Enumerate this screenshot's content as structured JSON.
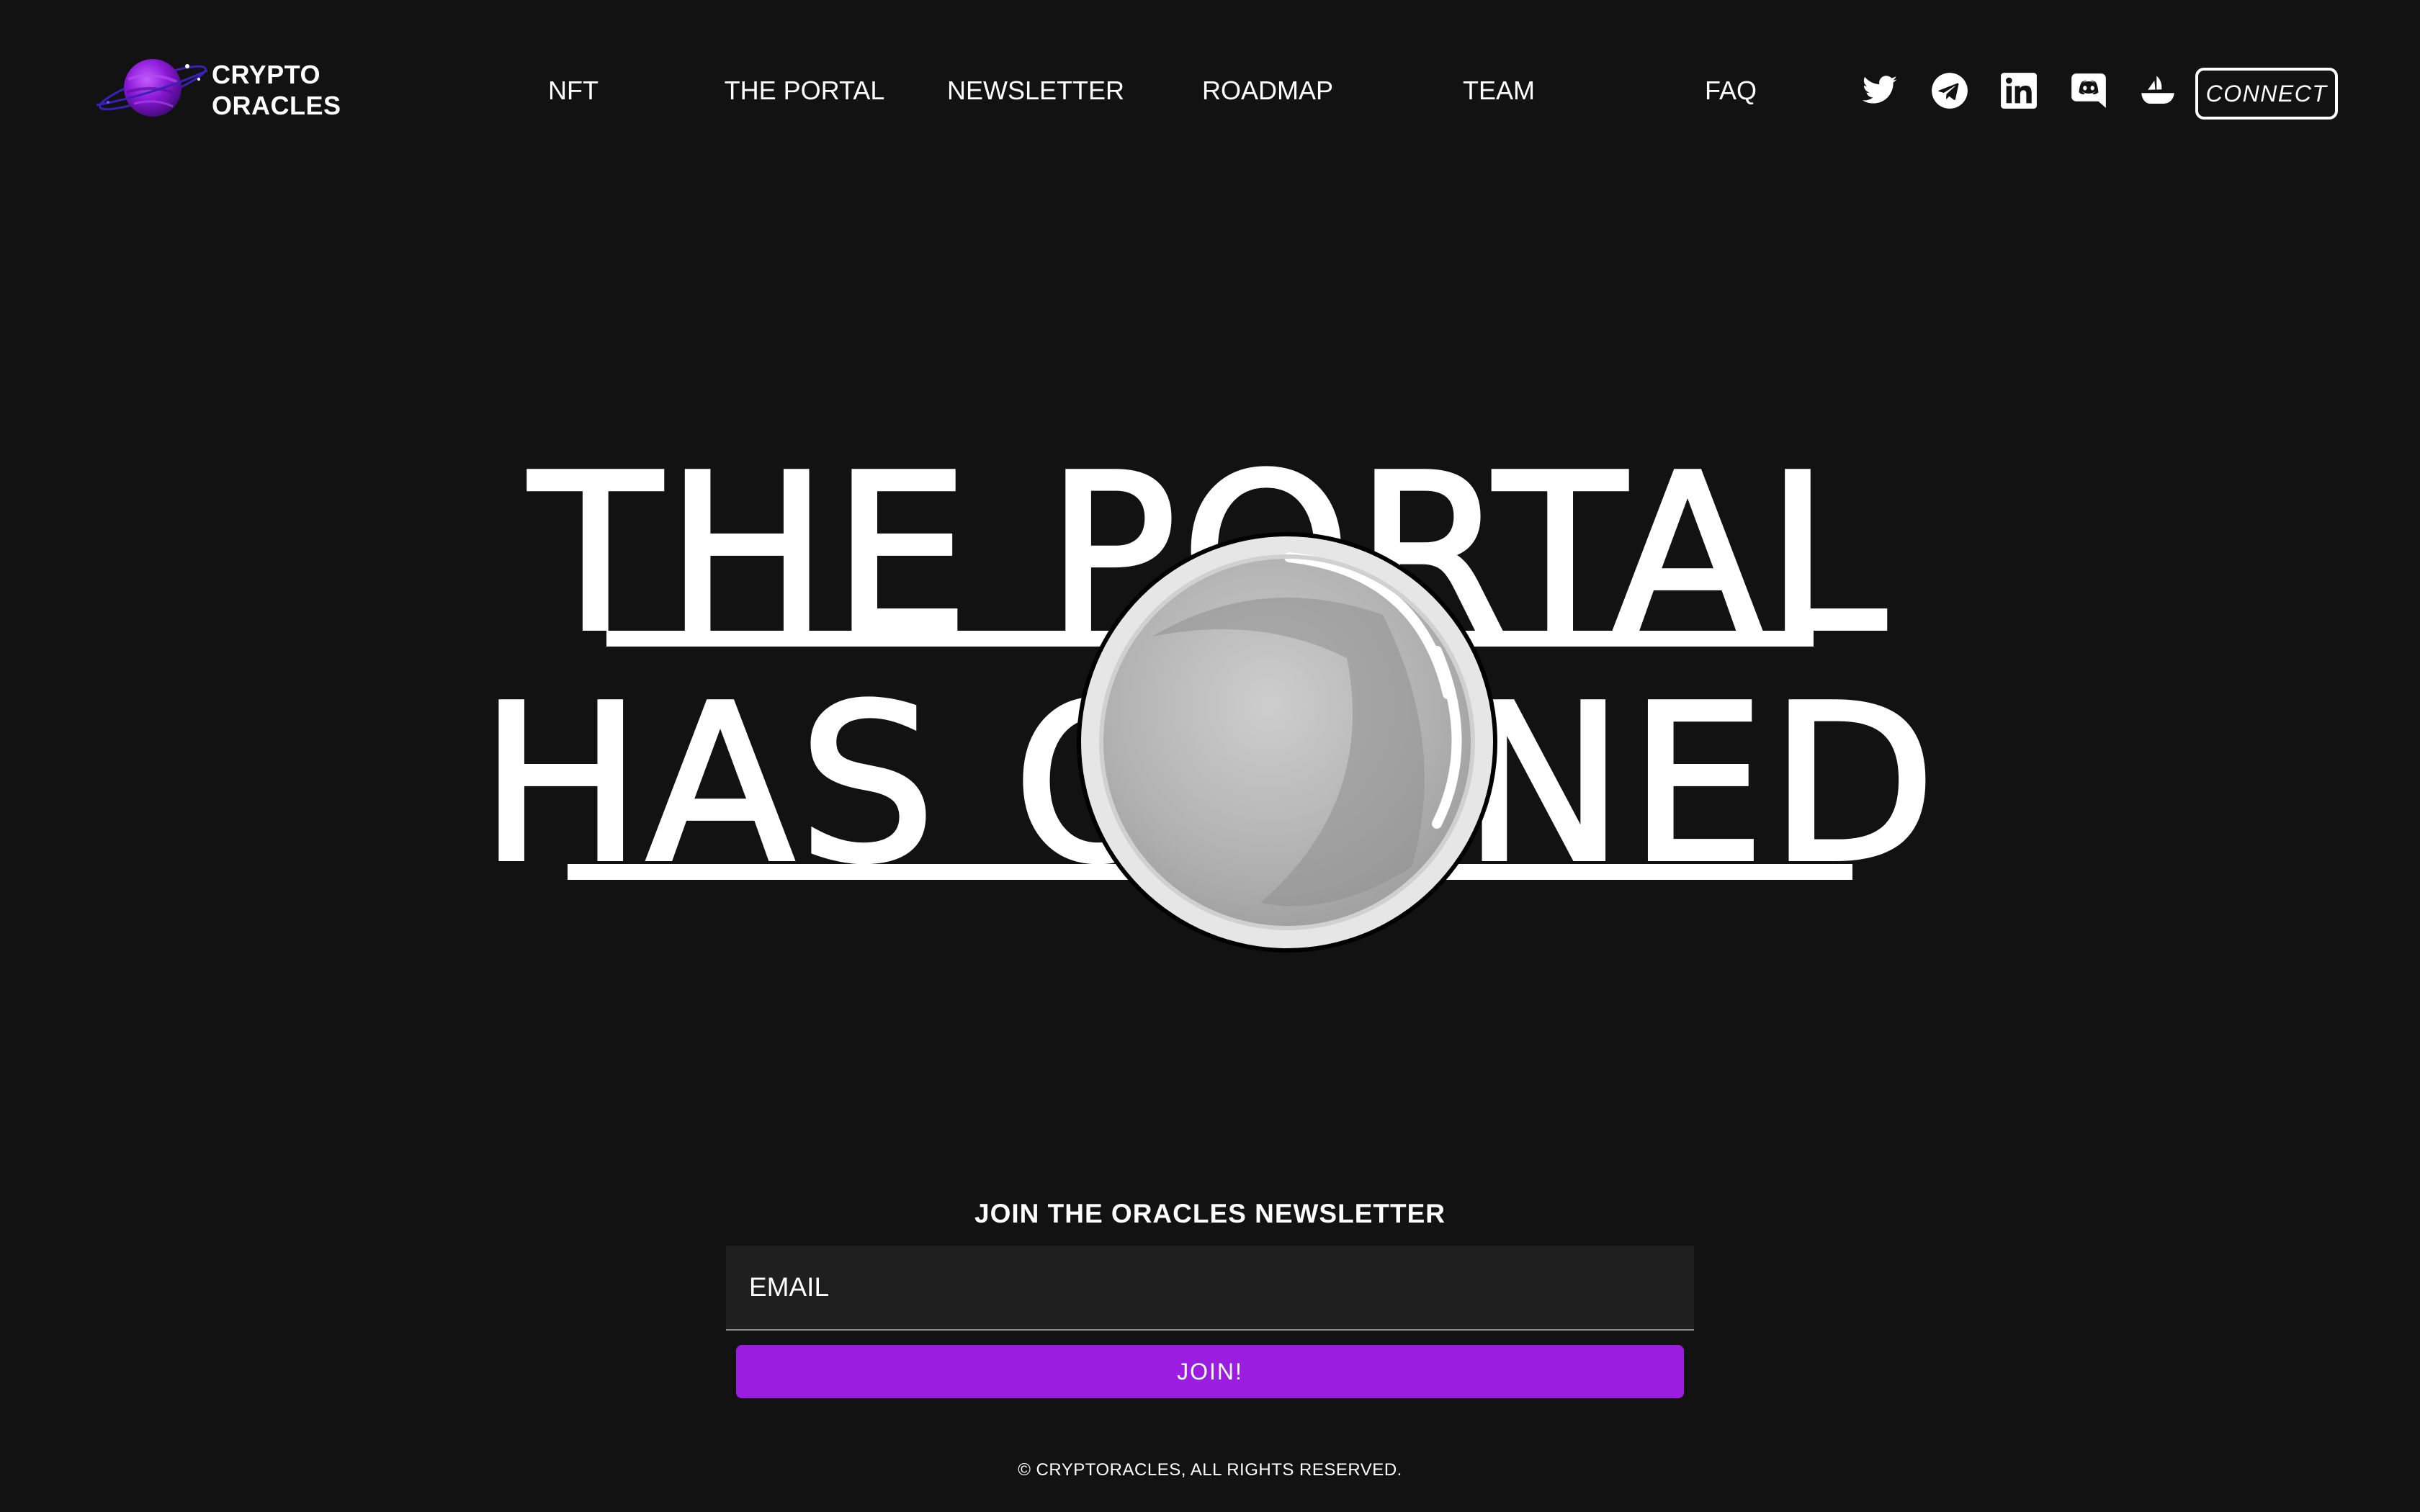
{
  "brand": {
    "line1": "CRYPTO",
    "line2": "ORACLES",
    "logo_icon": "planet-logo-icon",
    "color": "#9b1de0"
  },
  "nav": {
    "items": [
      {
        "label": "NFT"
      },
      {
        "label": "THE PORTAL"
      },
      {
        "label": "NEWSLETTER"
      },
      {
        "label": "ROADMAP"
      },
      {
        "label": "TEAM"
      },
      {
        "label": "FAQ"
      }
    ]
  },
  "socials": [
    {
      "icon": "twitter-icon"
    },
    {
      "icon": "telegram-icon"
    },
    {
      "icon": "linkedin-icon"
    },
    {
      "icon": "discord-icon"
    },
    {
      "icon": "opensea-icon"
    }
  ],
  "connect": {
    "label": "CONNECT"
  },
  "hero": {
    "line1": "THE PORTAL",
    "line2": "HAS OPENED",
    "orb_icon": "portal-orb-icon"
  },
  "newsletter": {
    "title": "JOIN THE ORACLES NEWSLETTER",
    "email_placeholder": "EMAIL",
    "email_value": "",
    "join_label": "JOIN!"
  },
  "footer": {
    "copyright": "© CRYPTORACLES, ALL RIGHTS RESERVED."
  },
  "colors": {
    "background": "#121212",
    "text": "#ffffff",
    "accent": "#9b1de0",
    "input_bg": "#1f1f1f"
  }
}
